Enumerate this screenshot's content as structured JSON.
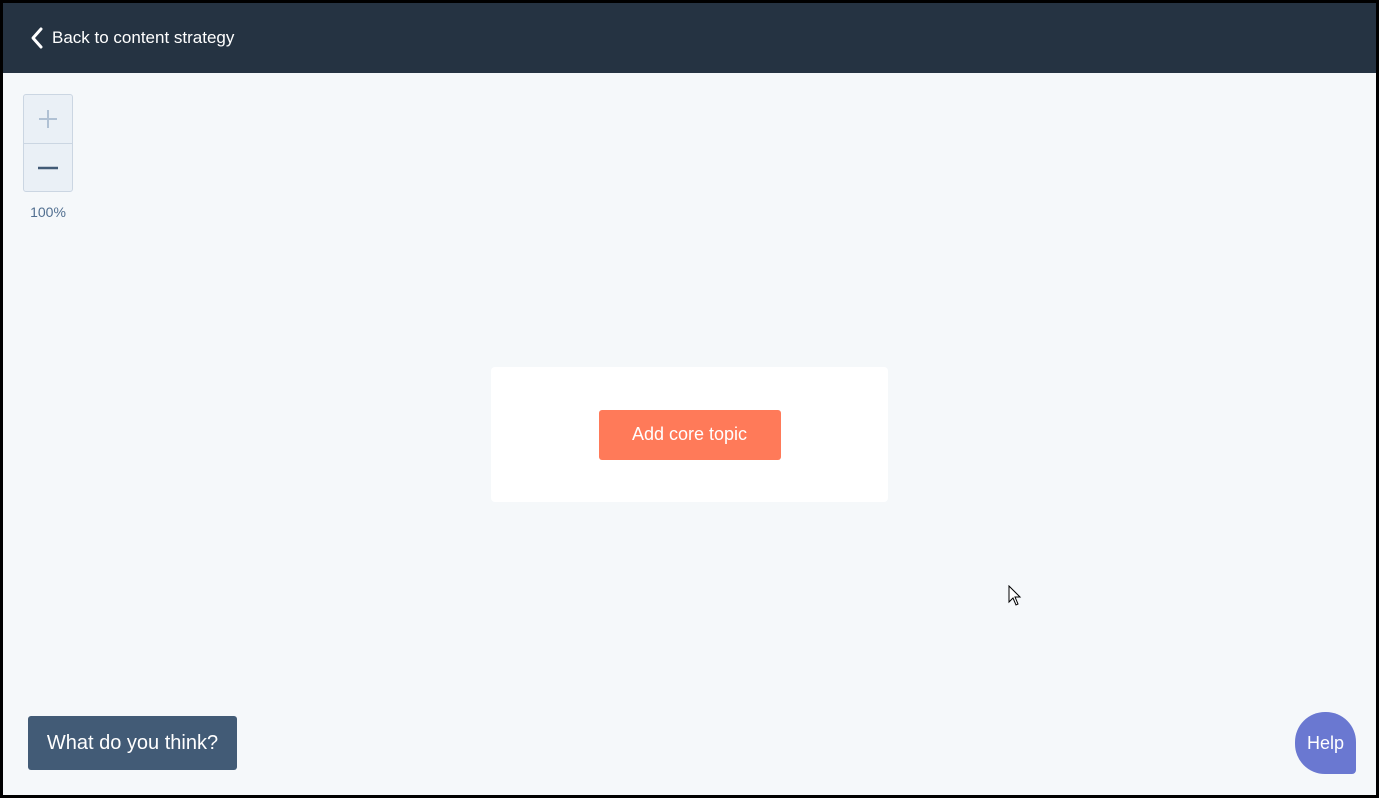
{
  "header": {
    "back_label": "Back to content strategy",
    "back_icon": "chevron-left-icon"
  },
  "zoom": {
    "in_icon": "plus-icon",
    "out_icon": "minus-icon",
    "level": "100%"
  },
  "canvas": {
    "add_core_topic_label": "Add core topic"
  },
  "feedback": {
    "label": "What do you think?"
  },
  "help": {
    "label": "Help"
  },
  "colors": {
    "header_bg": "#253342",
    "canvas_bg": "#f5f8fa",
    "primary_button": "#ff7a59",
    "feedback_button": "#425b76",
    "help_button": "#6a78d1"
  }
}
